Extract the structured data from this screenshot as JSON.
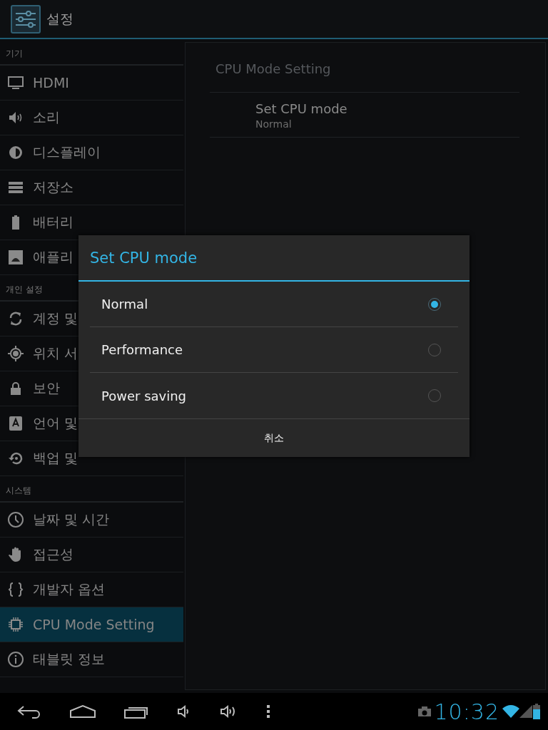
{
  "action_bar": {
    "title": "설정"
  },
  "sidebar": {
    "sections": [
      {
        "header": "기기",
        "items": [
          {
            "label": "HDMI",
            "kind": "monitor",
            "selected": false
          },
          {
            "label": "소리",
            "kind": "speaker",
            "selected": false
          },
          {
            "label": "디스플레이",
            "kind": "brightness",
            "selected": false
          },
          {
            "label": "저장소",
            "kind": "storage",
            "selected": false
          },
          {
            "label": "배터리",
            "kind": "battery",
            "selected": false
          },
          {
            "label": "애플리",
            "kind": "apps",
            "selected": false
          }
        ]
      },
      {
        "header": "개인 설정",
        "items": [
          {
            "label": "계정 및",
            "kind": "sync",
            "selected": false
          },
          {
            "label": "위치 서",
            "kind": "location",
            "selected": false
          },
          {
            "label": "보안",
            "kind": "lock",
            "selected": false
          },
          {
            "label": "언어 및",
            "kind": "language",
            "selected": false
          },
          {
            "label": "백업 및",
            "kind": "backup",
            "selected": false
          }
        ]
      },
      {
        "header": "시스템",
        "items": [
          {
            "label": "날짜 및 시간",
            "kind": "clock",
            "selected": false
          },
          {
            "label": "접근성",
            "kind": "hand",
            "selected": false
          },
          {
            "label": "개발자 옵션",
            "kind": "braces",
            "selected": false
          },
          {
            "label": "CPU Mode Setting",
            "kind": "chip",
            "selected": true
          },
          {
            "label": "태블릿 정보",
            "kind": "info",
            "selected": false
          }
        ]
      }
    ]
  },
  "detail": {
    "title": "CPU Mode Setting",
    "preferences": [
      {
        "title": "Set CPU mode",
        "summary": "Normal"
      }
    ]
  },
  "dialog": {
    "title": "Set CPU mode",
    "options": [
      {
        "label": "Normal",
        "selected": true
      },
      {
        "label": "Performance",
        "selected": false
      },
      {
        "label": "Power saving",
        "selected": false
      }
    ],
    "buttons": [
      "취소"
    ]
  },
  "nav_bar": {
    "clock": "10:32"
  }
}
